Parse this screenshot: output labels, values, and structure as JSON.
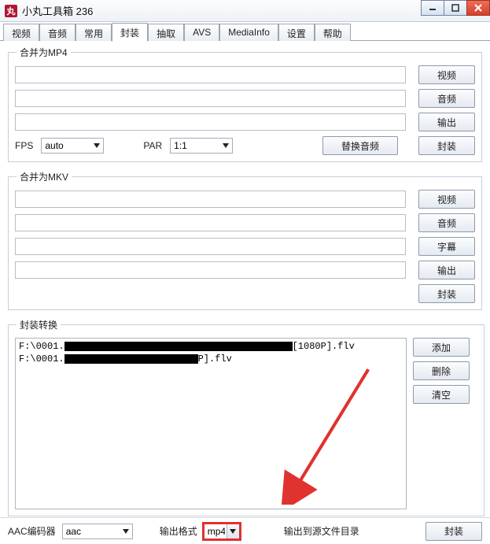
{
  "window": {
    "icon_text": "丸",
    "title": "小丸工具箱 236"
  },
  "tabs": [
    {
      "label": "视频"
    },
    {
      "label": "音频"
    },
    {
      "label": "常用"
    },
    {
      "label": "封装",
      "active": true
    },
    {
      "label": "抽取"
    },
    {
      "label": "AVS"
    },
    {
      "label": "MediaInfo"
    },
    {
      "label": "设置"
    },
    {
      "label": "帮助"
    }
  ],
  "mp4_group": {
    "title": "合并为MP4",
    "video_btn": "视频",
    "audio_btn": "音频",
    "output_btn": "输出",
    "fps_label": "FPS",
    "fps_value": "auto",
    "par_label": "PAR",
    "par_value": "1:1",
    "replace_audio_btn": "替换音频",
    "mux_btn": "封装"
  },
  "mkv_group": {
    "title": "合并为MKV",
    "video_btn": "视频",
    "audio_btn": "音频",
    "subtitle_btn": "字幕",
    "output_btn": "输出",
    "mux_btn": "封装"
  },
  "convert_group": {
    "title": "封装转换",
    "add_btn": "添加",
    "delete_btn": "删除",
    "clear_btn": "清空",
    "files": [
      {
        "prefix": "F:\\0001.",
        "suffix": "[1080P].flv"
      },
      {
        "prefix": "F:\\0001.",
        "suffix": "P].flv"
      }
    ]
  },
  "bottom": {
    "aac_label": "AAC编码器",
    "aac_value": "aac",
    "fmt_label": "输出格式",
    "fmt_value": "mp4",
    "out_dir_label": "输出到源文件目录",
    "mux_btn": "封装"
  }
}
